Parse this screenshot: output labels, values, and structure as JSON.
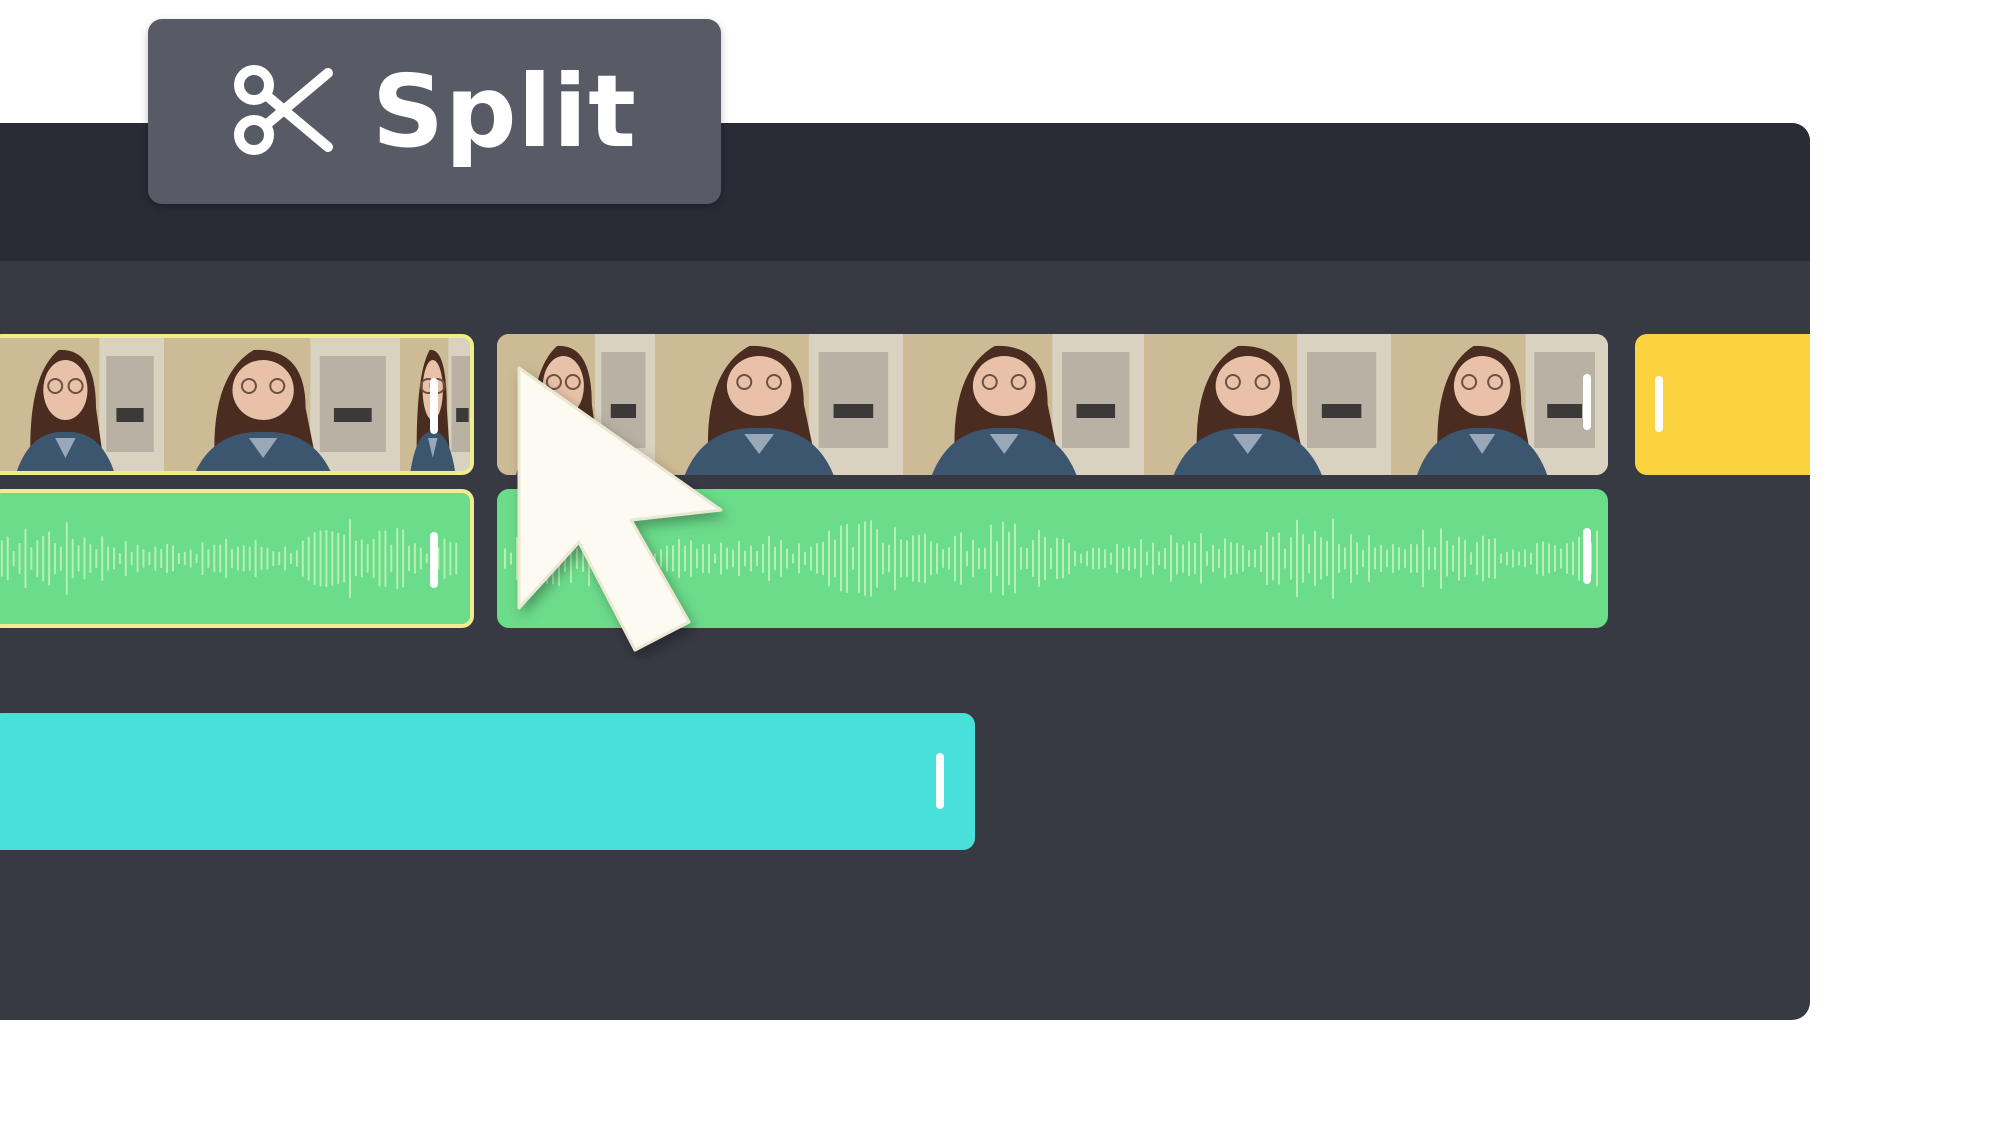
{
  "toolbar": {
    "split_label": "Split",
    "split_icon": "scissors-icon"
  },
  "colors": {
    "editor_bg": "#373943",
    "editor_header_bg": "#292b35",
    "split_button_bg": "#585a65",
    "selected_border": "#f1ed8f",
    "audio_clip": "#6bdc8a",
    "waveform": "#b7f0b3",
    "overlay_clip": "#fad33e",
    "teal_clip": "#48e0d8",
    "cursor_fill": "#fdfbf1"
  },
  "timeline": {
    "video_track": [
      "video-clip-selected",
      "video-clip",
      "yellow-clip"
    ],
    "audio_track": [
      "audio-clip-selected",
      "audio-clip"
    ],
    "extra_track": [
      "teal-clip"
    ]
  },
  "pointer": "mouse-cursor-icon"
}
